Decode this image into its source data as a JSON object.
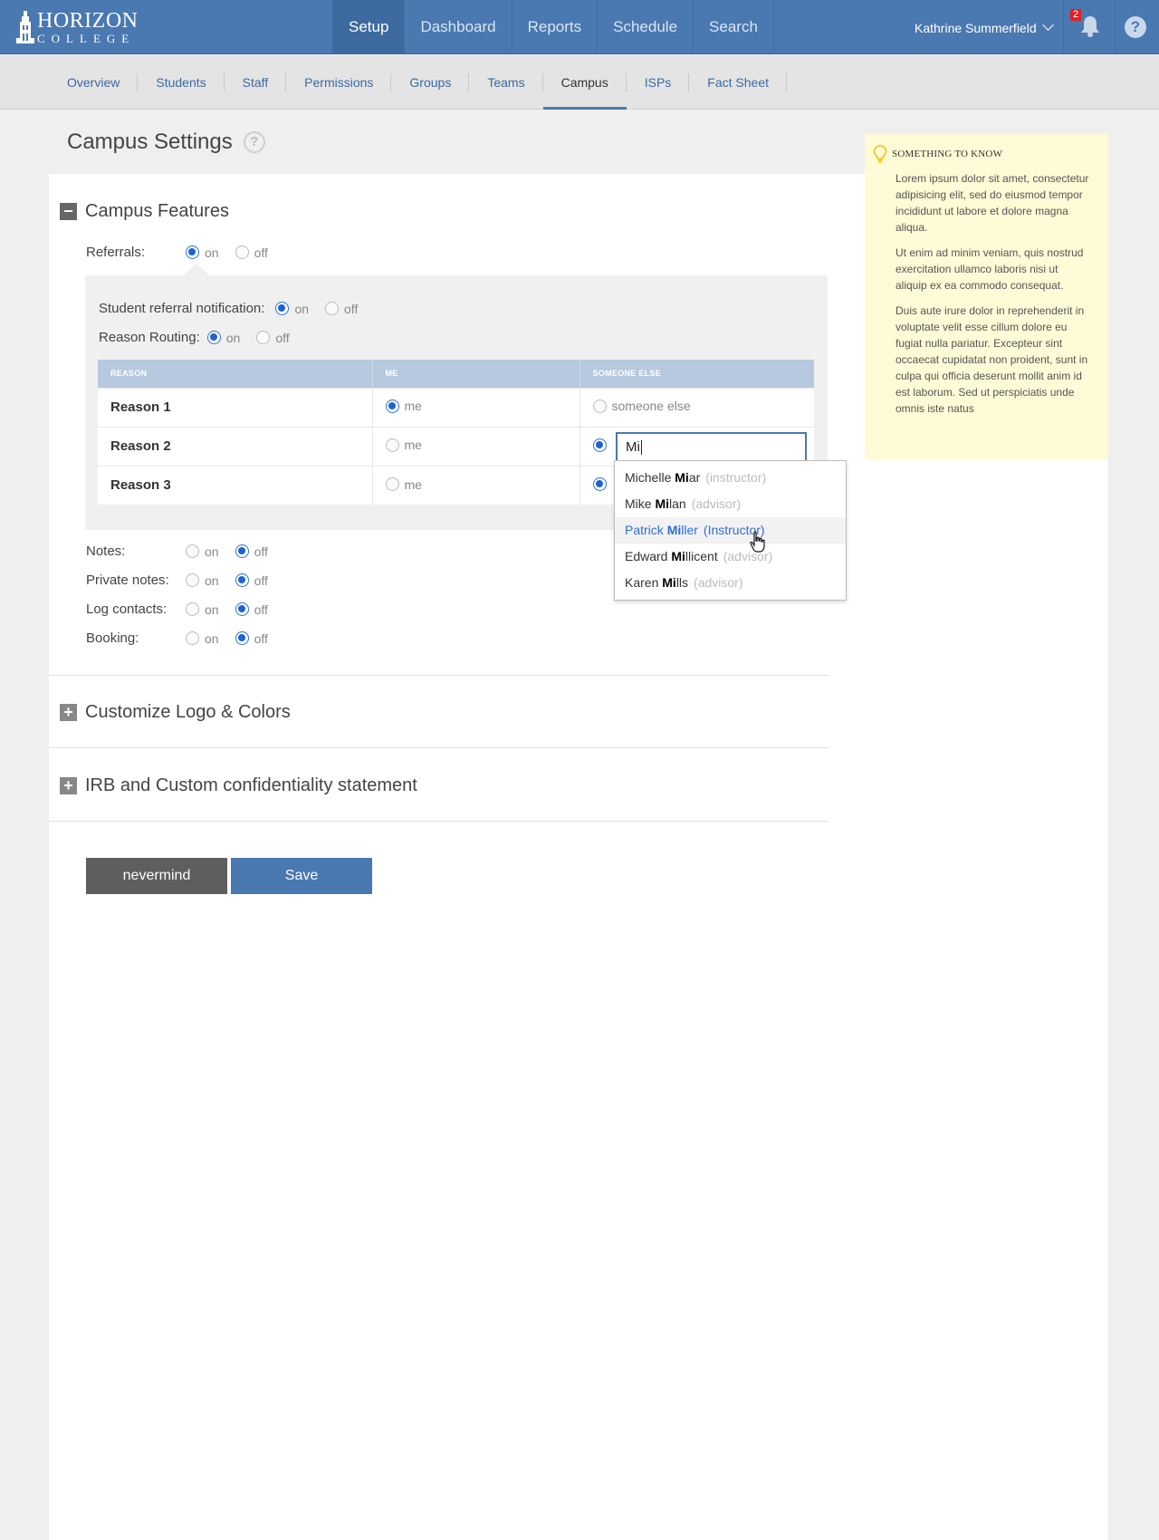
{
  "brand": {
    "line1": "HORIZON",
    "line2": "COLLEGE"
  },
  "main_nav": [
    {
      "label": "Setup",
      "active": true
    },
    {
      "label": "Dashboard"
    },
    {
      "label": "Reports"
    },
    {
      "label": "Schedule"
    },
    {
      "label": "Search"
    }
  ],
  "user": {
    "name": "Kathrine Summerfield"
  },
  "notifications": {
    "count": "2"
  },
  "help_label": "?",
  "sub_nav": [
    {
      "label": "Overview"
    },
    {
      "label": "Students"
    },
    {
      "label": "Staff"
    },
    {
      "label": "Permissions"
    },
    {
      "label": "Groups"
    },
    {
      "label": "Teams"
    },
    {
      "label": "Campus",
      "active": true
    },
    {
      "label": "ISPs"
    },
    {
      "label": "Fact Sheet"
    }
  ],
  "page": {
    "title": "Campus Settings",
    "help": "?"
  },
  "campus_features": {
    "heading": "Campus Features",
    "toggle": "−",
    "referrals": {
      "label": "Referrals:",
      "on": "on",
      "off": "off",
      "value": "on"
    },
    "student_referral_notification": {
      "label": "Student referral notification:",
      "on": "on",
      "off": "off",
      "value": "on"
    },
    "reason_routing": {
      "label": "Reason Routing:",
      "on": "on",
      "off": "off",
      "value": "on"
    },
    "routing_table": {
      "headers": [
        "REASON",
        "ME",
        "SOMEONE ELSE"
      ],
      "rows": [
        {
          "reason": "Reason 1",
          "me": "me",
          "someone_else": "someone else",
          "selected": "me"
        },
        {
          "reason": "Reason 2",
          "me": "me",
          "selected": "someone_else"
        },
        {
          "reason": "Reason 3",
          "me": "me",
          "selected": "someone_else"
        }
      ]
    },
    "lookup": {
      "value": "Mi",
      "suggestions": [
        {
          "pre": "Michelle ",
          "match": "Mi",
          "post": "ar",
          "role": "(instructor)"
        },
        {
          "pre": "Mike ",
          "match": "Mi",
          "post": "lan",
          "role": "(advisor)"
        },
        {
          "pre": "Patrick ",
          "match": "Mi",
          "post": "ller",
          "role": "(Instructor)",
          "hover": true
        },
        {
          "pre": "Edward ",
          "match": "Mi",
          "post": "llicent",
          "role": "(advisor)"
        },
        {
          "pre": "Karen ",
          "match": "Mi",
          "post": "lls",
          "role": "(advisor)"
        }
      ]
    },
    "notes": {
      "label": "Notes:",
      "on": "on",
      "off": "off",
      "value": "off"
    },
    "private_notes": {
      "label": "Private notes:",
      "on": "on",
      "off": "off",
      "value": "off"
    },
    "log_contacts": {
      "label": "Log contacts:",
      "on": "on",
      "off": "off",
      "value": "off"
    },
    "booking": {
      "label": "Booking:",
      "on": "on",
      "off": "off",
      "value": "off"
    }
  },
  "logo_colors": {
    "heading": "Customize Logo & Colors",
    "toggle": "+"
  },
  "irb": {
    "heading": "IRB and Custom confidentiality statement",
    "toggle": "+"
  },
  "actions": {
    "cancel": "nevermind",
    "save": "Save"
  },
  "tip": {
    "heading": "SOMETHING TO KNOW",
    "paragraphs": [
      "Lorem ipsum dolor sit amet, consectetur adipisicing elit, sed do eiusmod tempor incididunt ut labore et dolore magna aliqua.",
      " Ut enim ad minim veniam, quis nostrud exercitation ullamco laboris nisi ut aliquip ex ea commodo consequat.",
      "Duis aute irure dolor in reprehenderit in voluptate velit esse cillum dolore eu fugiat nulla pariatur. Excepteur sint occaecat cupidatat non proident, sunt in culpa qui officia deserunt mollit anim id est laborum. Sed ut perspiciatis unde omnis iste natus"
    ]
  },
  "colors": {
    "brand_blue": "#4a78b0",
    "radio_blue": "#1f63d1",
    "tip_bg": "#fffbd6",
    "badge_red": "#e02020"
  }
}
